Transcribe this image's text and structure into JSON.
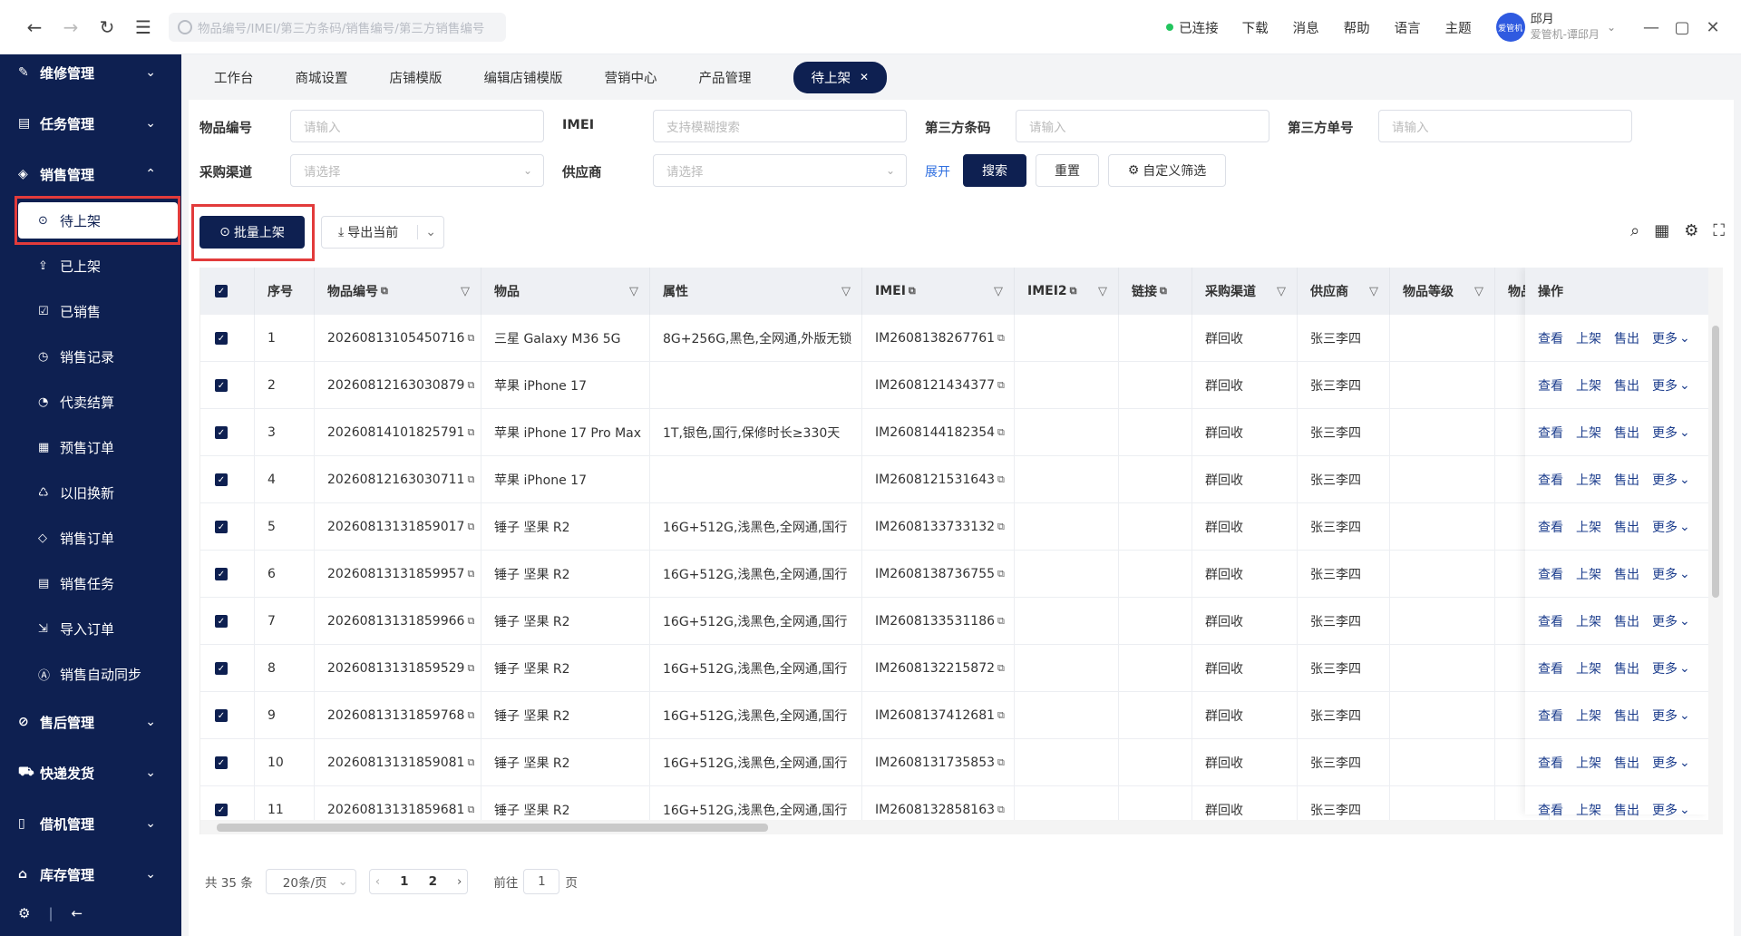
{
  "search": {
    "placeholder": "物品编号/IMEI/第三方条码/销售编号/第三方销售编号"
  },
  "topbar": {
    "connection": "已连接",
    "links": [
      "下载",
      "消息",
      "帮助",
      "语言",
      "主题"
    ],
    "user": {
      "name": "邱月",
      "org": "爱管机-谭邱月",
      "avatar_text": "爱管机"
    }
  },
  "sidebar": {
    "groups_top": [
      {
        "label": "维修管理",
        "icon": "wrench-icon"
      },
      {
        "label": "任务管理",
        "icon": "task-icon"
      },
      {
        "label": "销售管理",
        "icon": "cube-icon"
      }
    ],
    "sub_items": [
      {
        "label": "待上架",
        "icon": "shelf-icon"
      },
      {
        "label": "已上架",
        "icon": "upload-icon"
      },
      {
        "label": "已销售",
        "icon": "clipboard-icon"
      },
      {
        "label": "销售记录",
        "icon": "history-icon"
      },
      {
        "label": "代卖结算",
        "icon": "settle-icon"
      },
      {
        "label": "预售订单",
        "icon": "doc-icon"
      },
      {
        "label": "以旧换新",
        "icon": "recycle-icon"
      },
      {
        "label": "销售订单",
        "icon": "tag-icon"
      },
      {
        "label": "销售任务",
        "icon": "list-icon"
      },
      {
        "label": "导入订单",
        "icon": "import-icon"
      },
      {
        "label": "销售自动同步",
        "icon": "sync-icon"
      }
    ],
    "groups_bottom": [
      {
        "label": "售后管理",
        "icon": "shield-icon"
      },
      {
        "label": "快递发货",
        "icon": "truck-icon"
      },
      {
        "label": "借机管理",
        "icon": "phone-icon"
      },
      {
        "label": "库存管理",
        "icon": "warehouse-icon"
      }
    ]
  },
  "tabs": [
    "工作台",
    "商城设置",
    "店铺模版",
    "编辑店铺模版",
    "营销中心",
    "产品管理"
  ],
  "active_tab": "待上架",
  "filters": {
    "item_no": {
      "label": "物品编号",
      "placeholder": "请输入"
    },
    "imei": {
      "label": "IMEI",
      "placeholder": "支持模糊搜索"
    },
    "third_barcode": {
      "label": "第三方条码",
      "placeholder": "请输入"
    },
    "third_order": {
      "label": "第三方单号",
      "placeholder": "请输入"
    },
    "channel": {
      "label": "采购渠道",
      "placeholder": "请选择"
    },
    "supplier": {
      "label": "供应商",
      "placeholder": "请选择"
    },
    "expand": "展开",
    "search_btn": "搜索",
    "reset_btn": "重置",
    "custom_btn": "自定义筛选"
  },
  "toolbar": {
    "batch_btn": "批量上架",
    "export_btn": "导出当前"
  },
  "table": {
    "columns": [
      "序号",
      "物品编号",
      "物品",
      "属性",
      "IMEI",
      "IMEI2",
      "链接",
      "采购渠道",
      "供应商",
      "物品等级",
      "物品",
      "操作"
    ],
    "actions": [
      "查看",
      "上架",
      "售出",
      "更多"
    ],
    "rows": [
      {
        "no": "1",
        "code": "20260813105450716",
        "item": "三星 Galaxy M36 5G",
        "attr": "8G+256G,黑色,全网通,外版无锁",
        "imei": "IM2608138267761",
        "channel": "群回收",
        "supplier": "张三李四"
      },
      {
        "no": "2",
        "code": "20260812163030879",
        "item": "苹果 iPhone 17",
        "attr": "",
        "imei": "IM2608121434377",
        "channel": "群回收",
        "supplier": "张三李四"
      },
      {
        "no": "3",
        "code": "20260814101825791",
        "item": "苹果 iPhone 17 Pro Max",
        "attr": "1T,银色,国行,保修时长≥330天",
        "imei": "IM2608144182354",
        "channel": "群回收",
        "supplier": "张三李四"
      },
      {
        "no": "4",
        "code": "20260812163030711",
        "item": "苹果 iPhone 17",
        "attr": "",
        "imei": "IM2608121531643",
        "channel": "群回收",
        "supplier": "张三李四"
      },
      {
        "no": "5",
        "code": "20260813131859017",
        "item": "锤子 坚果 R2",
        "attr": "16G+512G,浅黑色,全网通,国行",
        "imei": "IM2608133733132",
        "channel": "群回收",
        "supplier": "张三李四"
      },
      {
        "no": "6",
        "code": "20260813131859957",
        "item": "锤子 坚果 R2",
        "attr": "16G+512G,浅黑色,全网通,国行",
        "imei": "IM2608138736755",
        "channel": "群回收",
        "supplier": "张三李四"
      },
      {
        "no": "7",
        "code": "20260813131859966",
        "item": "锤子 坚果 R2",
        "attr": "16G+512G,浅黑色,全网通,国行",
        "imei": "IM2608133531186",
        "channel": "群回收",
        "supplier": "张三李四"
      },
      {
        "no": "8",
        "code": "20260813131859529",
        "item": "锤子 坚果 R2",
        "attr": "16G+512G,浅黑色,全网通,国行",
        "imei": "IM2608132215872",
        "channel": "群回收",
        "supplier": "张三李四"
      },
      {
        "no": "9",
        "code": "20260813131859768",
        "item": "锤子 坚果 R2",
        "attr": "16G+512G,浅黑色,全网通,国行",
        "imei": "IM2608137412681",
        "channel": "群回收",
        "supplier": "张三李四"
      },
      {
        "no": "10",
        "code": "20260813131859081",
        "item": "锤子 坚果 R2",
        "attr": "16G+512G,浅黑色,全网通,国行",
        "imei": "IM2608131735853",
        "channel": "群回收",
        "supplier": "张三李四"
      },
      {
        "no": "11",
        "code": "20260813131859681",
        "item": "锤子 坚果 R2",
        "attr": "16G+512G,浅黑色,全网通,国行",
        "imei": "IM2608132858163",
        "channel": "群回收",
        "supplier": "张三李四"
      }
    ]
  },
  "pager": {
    "total": "共 35 条",
    "page_size": "20条/页",
    "pages": [
      "1",
      "2"
    ],
    "goto_label": "前往",
    "goto_value": "1",
    "page_suffix": "页"
  },
  "colors": {
    "primary": "#0e2051",
    "highlight_box": "#e23b3b",
    "connected": "#22c55e"
  }
}
